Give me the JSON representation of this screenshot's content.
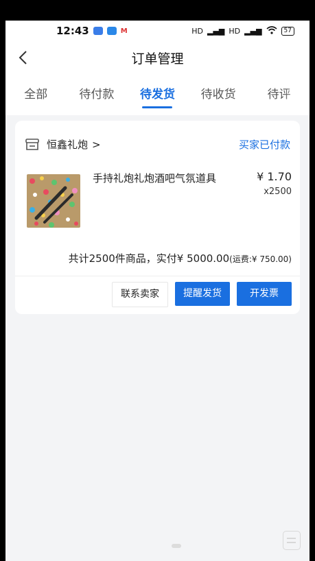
{
  "status_bar": {
    "time": "12:43",
    "signal_1": "HD",
    "signal_2": "HD",
    "battery": "57"
  },
  "header": {
    "title": "订单管理",
    "back_icon": "chevron-left-icon"
  },
  "tabs": [
    {
      "label": "全部",
      "active": false
    },
    {
      "label": "待付款",
      "active": false
    },
    {
      "label": "待发货",
      "active": true
    },
    {
      "label": "待收货",
      "active": false
    },
    {
      "label": "待评",
      "active": false
    }
  ],
  "order": {
    "shop_name": "恒鑫礼炮",
    "shop_chevron": ">",
    "status": "买家已付款",
    "product": {
      "name": "手持礼炮礼炮酒吧气氛道具",
      "price": "¥ 1.70",
      "quantity": "x2500"
    },
    "summary": {
      "text": "共计2500件商品，实付¥ 5000.00",
      "shipping": "(运费:¥ 750.00)"
    },
    "actions": {
      "contact_seller": "联系卖家",
      "remind_ship": "提醒发货",
      "invoice": "开发票"
    }
  },
  "colors": {
    "accent": "#1a6fe0",
    "background": "#f3f4f6"
  }
}
